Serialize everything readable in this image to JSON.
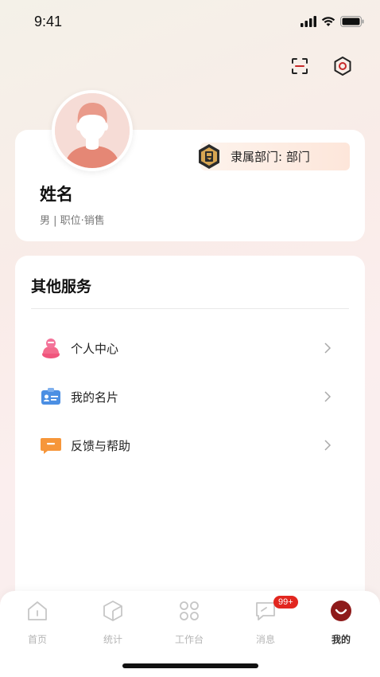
{
  "status": {
    "time": "9:41"
  },
  "profile": {
    "name": "姓名",
    "meta": "男 | 职位·销售",
    "department_label": "隶属部门: 部门"
  },
  "services": {
    "title": "其他服务",
    "items": [
      {
        "label": "个人中心",
        "icon": "person-center-icon"
      },
      {
        "label": "我的名片",
        "icon": "business-card-icon"
      },
      {
        "label": "反馈与帮助",
        "icon": "feedback-icon"
      }
    ]
  },
  "tabbar": {
    "tabs": [
      {
        "label": "首页",
        "icon": "home-icon",
        "active": false
      },
      {
        "label": "统计",
        "icon": "stats-icon",
        "active": false
      },
      {
        "label": "工作台",
        "icon": "workbench-icon",
        "active": false
      },
      {
        "label": "消息",
        "icon": "message-icon",
        "active": false,
        "badge": "99+"
      },
      {
        "label": "我的",
        "icon": "mine-icon",
        "active": true
      }
    ]
  },
  "colors": {
    "accent": "#8e1a1a",
    "badge": "#e2261f",
    "inactive": "#b5b5b5"
  }
}
